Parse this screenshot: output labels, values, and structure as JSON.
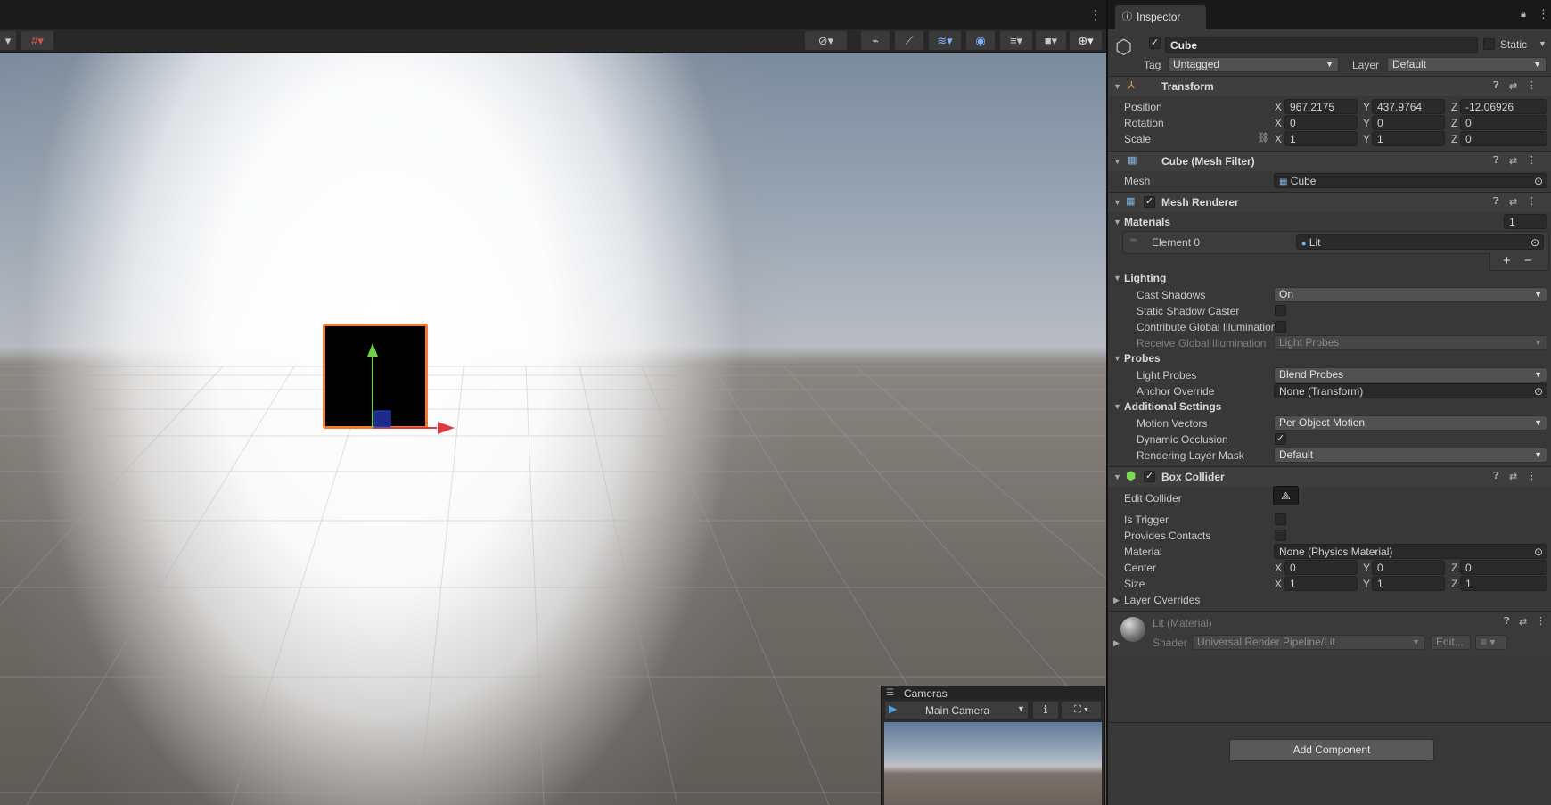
{
  "scene": {
    "more_icon": "vertical-ellipsis-icon",
    "toolbar_icons": [
      "orbit-gizmo-icon",
      "pivot-icon",
      "snap-icon",
      "layers-icon",
      "visibility-icon",
      "render-layers-icon",
      "camera-icon",
      "gizmos-icon"
    ]
  },
  "cameras_overlay": {
    "title": "Cameras",
    "camera_select": "Main Camera"
  },
  "inspector": {
    "tab": "Inspector",
    "object": {
      "name": "Cube",
      "static_label": "Static",
      "tag_label": "Tag",
      "tag_value": "Untagged",
      "layer_label": "Layer",
      "layer_value": "Default"
    },
    "transform": {
      "title": "Transform",
      "position_label": "Position",
      "rotation_label": "Rotation",
      "scale_label": "Scale",
      "position": {
        "x": "967.2175",
        "y": "437.9764",
        "z": "-12.06926"
      },
      "rotation": {
        "x": "0",
        "y": "0",
        "z": "0"
      },
      "scale": {
        "x": "1",
        "y": "1",
        "z": "0"
      },
      "axis_x": "X",
      "axis_y": "Y",
      "axis_z": "Z"
    },
    "mesh_filter": {
      "title": "Cube (Mesh Filter)",
      "mesh_label": "Mesh",
      "mesh_value": "Cube"
    },
    "mesh_renderer": {
      "title": "Mesh Renderer",
      "materials_label": "Materials",
      "materials_count": "1",
      "element_label": "Element 0",
      "element_value": "Lit",
      "add_symbol": "+",
      "remove_symbol": "−",
      "lighting_label": "Lighting",
      "cast_shadows_label": "Cast Shadows",
      "cast_shadows_value": "On",
      "static_shadow_caster_label": "Static Shadow Caster",
      "contribute_gi_label": "Contribute Global Illumination",
      "receive_gi_label": "Receive Global Illumination",
      "receive_gi_value": "Light Probes",
      "probes_label": "Probes",
      "light_probes_label": "Light Probes",
      "light_probes_value": "Blend Probes",
      "anchor_override_label": "Anchor Override",
      "anchor_override_value": "None (Transform)",
      "additional_settings_label": "Additional Settings",
      "motion_vectors_label": "Motion Vectors",
      "motion_vectors_value": "Per Object Motion",
      "dynamic_occlusion_label": "Dynamic Occlusion",
      "rendering_layer_mask_label": "Rendering Layer Mask",
      "rendering_layer_mask_value": "Default"
    },
    "box_collider": {
      "title": "Box Collider",
      "edit_collider_label": "Edit Collider",
      "is_trigger_label": "Is Trigger",
      "provides_contacts_label": "Provides Contacts",
      "material_label": "Material",
      "material_value": "None (Physics Material)",
      "center_label": "Center",
      "size_label": "Size",
      "center": {
        "x": "0",
        "y": "0",
        "z": "0"
      },
      "size": {
        "x": "1",
        "y": "1",
        "z": "1"
      },
      "layer_overrides_label": "Layer Overrides"
    },
    "material": {
      "title": "Lit (Material)",
      "shader_label": "Shader",
      "shader_value": "Universal Render Pipeline/Lit",
      "edit_label": "Edit..."
    },
    "add_component": "Add Component"
  }
}
